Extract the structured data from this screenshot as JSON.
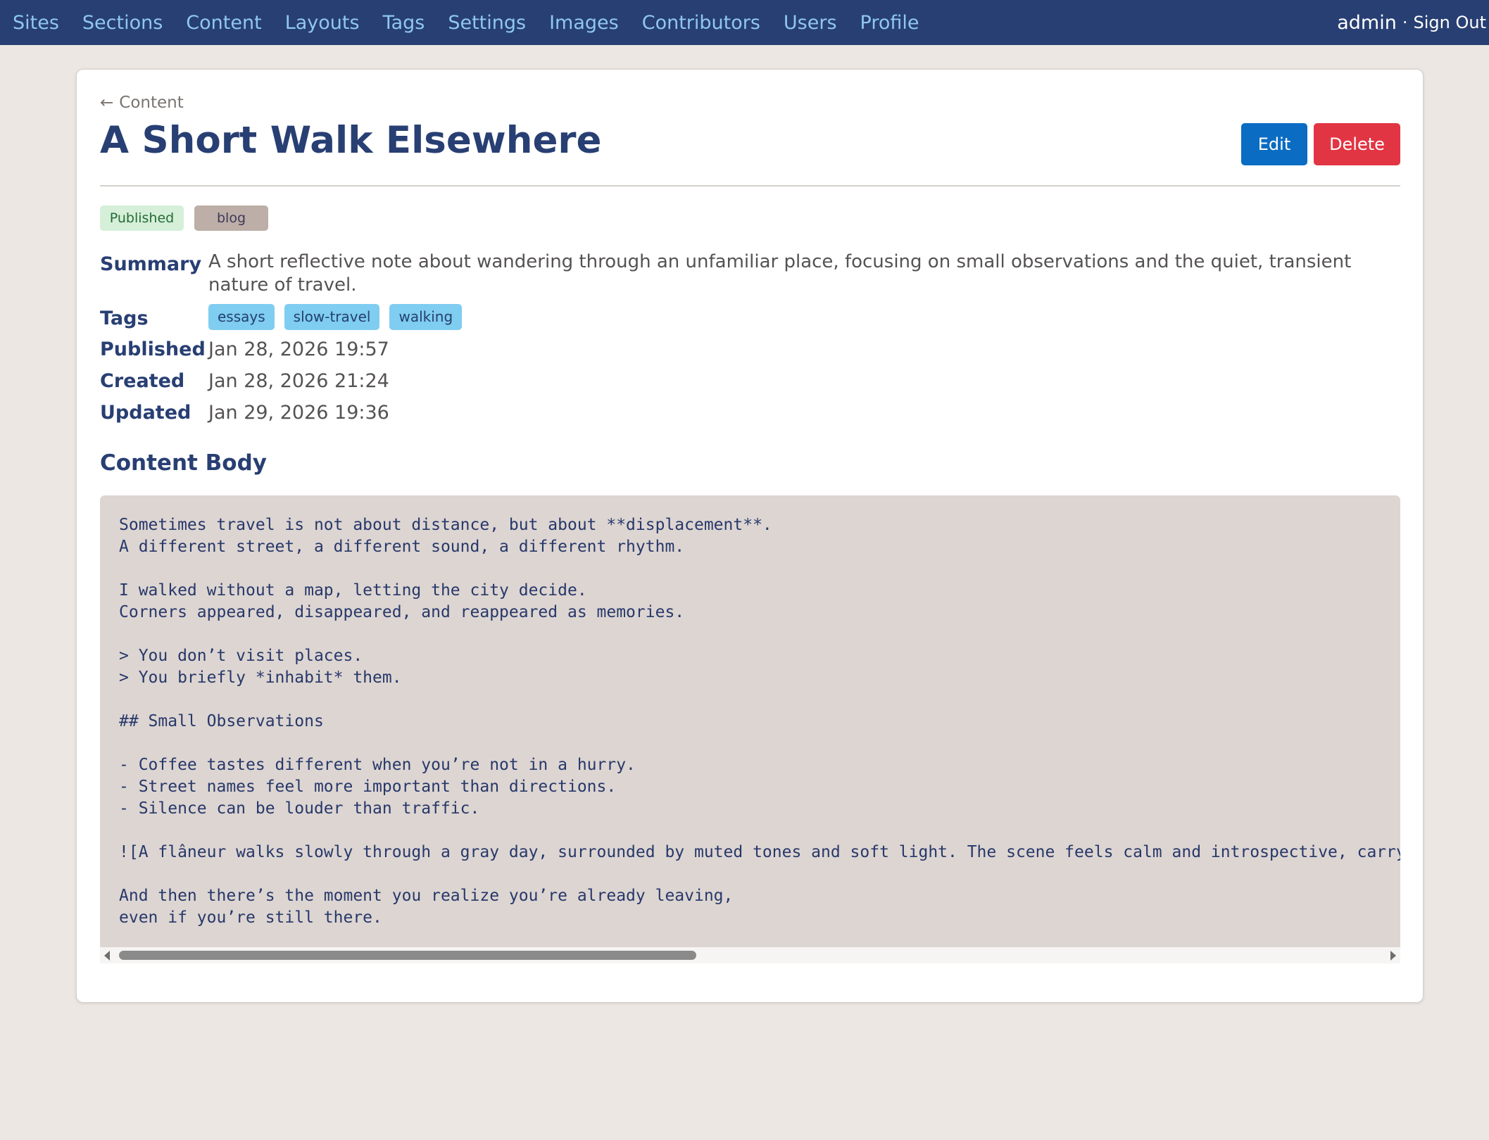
{
  "nav": {
    "links": [
      "Sites",
      "Sections",
      "Content",
      "Layouts",
      "Tags",
      "Settings",
      "Images",
      "Contributors",
      "Users",
      "Profile"
    ],
    "user": "admin",
    "separator": "·",
    "sign_out": "Sign Out"
  },
  "page": {
    "back_link": "Content",
    "back_icon": "arrow-left-icon",
    "title": "A Short Walk Elsewhere",
    "edit_label": "Edit",
    "delete_label": "Delete"
  },
  "badges": {
    "status": "Published",
    "section": "blog"
  },
  "fields": {
    "summary_label": "Summary",
    "summary": "A short reflective note about wandering through an unfamiliar place, focusing on small observations and the quiet, transient nature of travel.",
    "tags_label": "Tags",
    "tags": [
      "essays",
      "slow-travel",
      "walking"
    ],
    "published_label": "Published",
    "published": "Jan 28, 2026 19:57",
    "created_label": "Created",
    "created": "Jan 28, 2026 21:24",
    "updated_label": "Updated",
    "updated": "Jan 29, 2026 19:36"
  },
  "content_body": {
    "heading": "Content Body",
    "text": "Sometimes travel is not about distance, but about **displacement**.\nA different street, a different sound, a different rhythm.\n\nI walked without a map, letting the city decide.\nCorners appeared, disappeared, and reappeared as memories.\n\n> You don’t visit places.\n> You briefly *inhabit* them.\n\n## Small Observations\n\n- Coffee tastes different when you’re not in a hurry.\n- Street names feel more important than directions.\n- Silence can be louder than traffic.\n\n![A flâneur walks slowly through a gray day, surrounded by muted tones and soft light. The scene feels calm and introspective, carry\n\nAnd then there’s the moment you realize you’re already leaving,\neven if you’re still there."
  },
  "colors": {
    "nav_bg": "#283f73",
    "nav_link": "#8fc7ef",
    "heading": "#283f73",
    "edit_button": "#0a6cc2",
    "delete_button": "#e23543",
    "status_badge_bg": "#d5efd9",
    "section_badge_bg": "#bdaea8",
    "tag_bg": "#7fcdf0",
    "code_bg": "#ddd5d1"
  }
}
